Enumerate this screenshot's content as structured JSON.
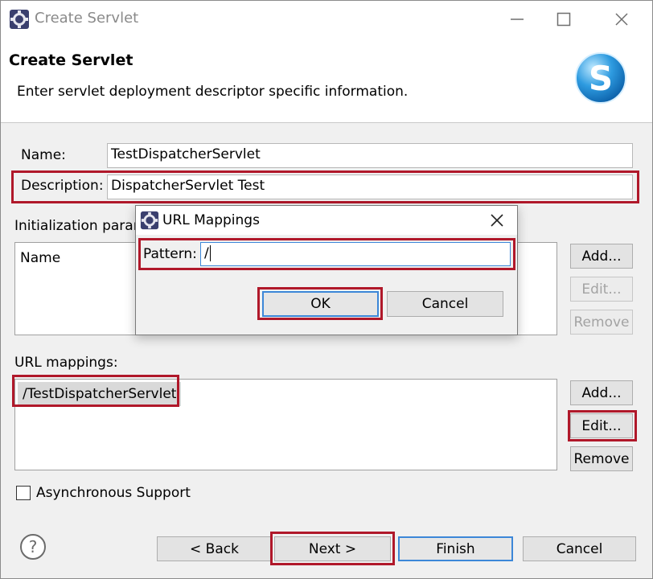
{
  "window": {
    "title": "Create Servlet",
    "controls": {
      "minimize_icon": "minimize-icon",
      "maximize_icon": "maximize-icon",
      "close_icon": "close-icon"
    }
  },
  "banner": {
    "title": "Create Servlet",
    "description": "Enter servlet deployment descriptor specific information."
  },
  "form": {
    "name_label": "Name:",
    "name_value": "TestDispatcherServlet",
    "description_label": "Description:",
    "description_value": "DispatcherServlet Test",
    "init_params_label": "Initialization parar",
    "init_params_column": "Name",
    "init_buttons": {
      "add": "Add...",
      "edit": "Edit...",
      "remove": "Remove"
    },
    "url_mappings_label": "URL mappings:",
    "url_mappings": [
      "/TestDispatcherServlet"
    ],
    "url_buttons": {
      "add": "Add...",
      "edit": "Edit...",
      "remove": "Remove"
    },
    "async_label": "Asynchronous Support",
    "async_checked": false
  },
  "footer": {
    "help_symbol": "?",
    "back": "< Back",
    "next": "Next >",
    "finish": "Finish",
    "cancel": "Cancel"
  },
  "modal": {
    "title": "URL Mappings",
    "pattern_label": "Pattern:",
    "pattern_value": "/",
    "ok": "OK",
    "cancel": "Cancel"
  },
  "colors": {
    "highlight_red": "#b0182a",
    "focus_blue": "#3c87d8",
    "dialog_bg": "#f0f0f0"
  }
}
